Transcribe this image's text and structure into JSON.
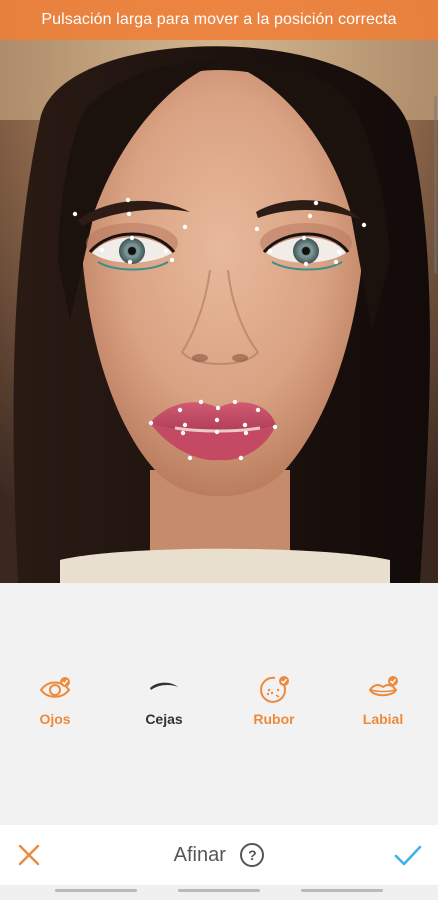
{
  "hint": {
    "text": "Pulsación larga para mover a la posición correcta"
  },
  "tools": [
    {
      "id": "ojos",
      "label": "Ojos",
      "icon": "eye-check-icon",
      "active": false,
      "color": "#ee8a3c"
    },
    {
      "id": "cejas",
      "label": "Cejas",
      "icon": "eyebrow-icon",
      "active": true,
      "color": "#333333"
    },
    {
      "id": "rubor",
      "label": "Rubor",
      "icon": "blush-check-icon",
      "active": false,
      "color": "#ee8a3c"
    },
    {
      "id": "labial",
      "label": "Labial",
      "icon": "lips-check-icon",
      "active": false,
      "color": "#ee8a3c"
    }
  ],
  "bottom_bar": {
    "title": "Afinar",
    "help_label": "?",
    "cancel_icon": "close-icon",
    "confirm_icon": "check-icon"
  },
  "colors": {
    "accent_orange": "#ee8a3c",
    "confirm_blue": "#3fb3e6",
    "banner_orange": "#ee803a"
  }
}
